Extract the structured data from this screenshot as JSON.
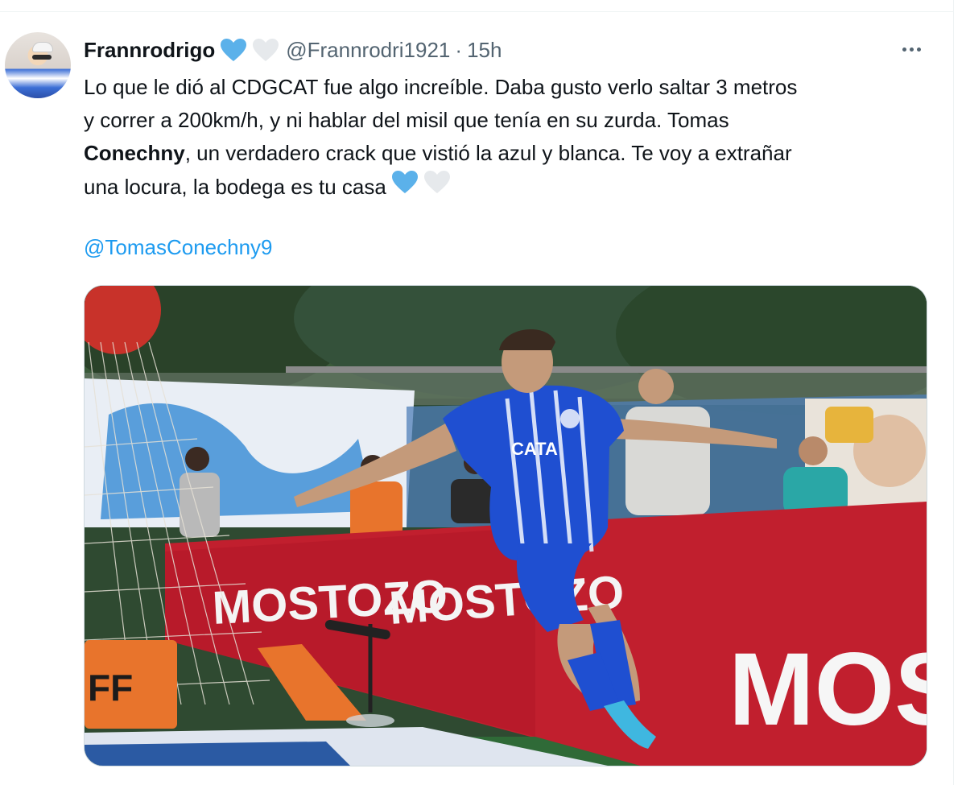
{
  "tweet": {
    "display_name": "Frannrodrigo",
    "handle": "@Frannrodri1921",
    "separator": "·",
    "timestamp": "15h",
    "text_lines": [
      "Lo que le dió al CDGCAT fue algo increíble. Daba gusto verlo saltar 3 metros",
      "y correr a 200km/h, y ni hablar del misil que tenía en su zurda. Tomas",
      "un verdadero crack que vistió la azul y blanca. Te voy a extrañar",
      "una locura, la bodega es tu casa"
    ],
    "bold_word": "Conechny",
    "bold_suffix": ",",
    "mention": "@TomasConechny9",
    "heart_colors": [
      "#5bb1ea",
      "#e6e9ec"
    ]
  },
  "photo": {
    "sponsor_text": "MOSTOZO",
    "shirt_text": "CATA",
    "board_text": "FF"
  }
}
